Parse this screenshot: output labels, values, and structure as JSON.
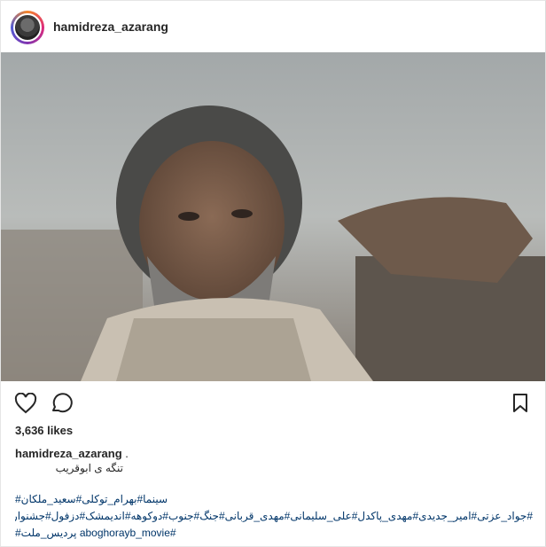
{
  "header": {
    "username": "hamidreza_azarang"
  },
  "photo": {
    "alt": ""
  },
  "actions": {
    "like_icon": "heart-icon",
    "comment_icon": "comment-icon",
    "save_icon": "bookmark-icon"
  },
  "post": {
    "likes": "3,636 likes",
    "caption_username": "hamidreza_azarang",
    "caption_dot": ".",
    "caption_text": "تنگه ی ابوقریب",
    "hashtags_line1": "سینما#بهرام_توکلی#سعید_ملکان#",
    "hashtags_line2": "#جواد_عزتی#امیر_جدیدی#مهدی_پاکدل#علی_سلیمانی#مهدی_قربانی#جنگ#جنوب#دوکوهه#اندیمشک#دزفول#جشنواره_فجر#",
    "hashtags_line3": "#aboghorayb_movie پردیس_ملت#"
  },
  "colors": {
    "text": "#262626",
    "hashtag": "#003569",
    "border": "#e6e6e6"
  }
}
